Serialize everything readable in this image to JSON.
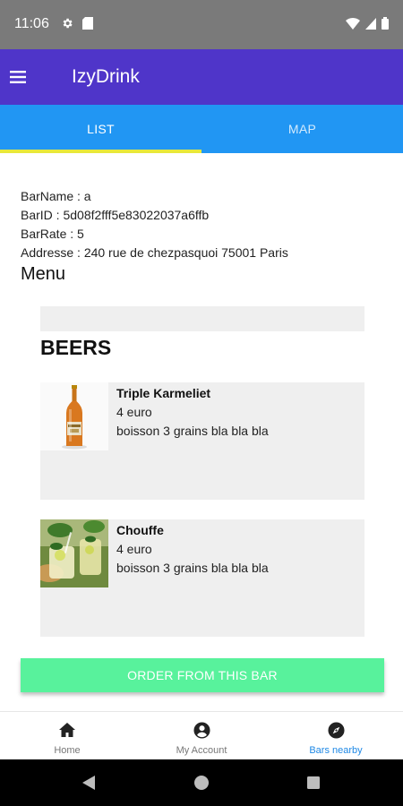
{
  "status_bar": {
    "time": "11:06",
    "icons": [
      "gear-icon",
      "sim-card-icon",
      "wifi-icon",
      "signal-icon",
      "battery-icon"
    ]
  },
  "app_bar": {
    "title": "IzyDrink",
    "menu_icon": "hamburger-menu-icon",
    "color": "#4f35c9"
  },
  "tabs": {
    "items": [
      {
        "label": "LIST",
        "active": true
      },
      {
        "label": "MAP",
        "active": false
      }
    ],
    "background": "#2196f3",
    "indicator_color": "#e8e83a"
  },
  "bar_info": {
    "name": "BarName : a",
    "id": "BarID : 5d08f2fff5e83022037a6ffb",
    "rate": "BarRate : 5",
    "address": "Addresse : 240 rue de chezpasquoi 75001 Paris"
  },
  "menu_heading": "Menu",
  "menu": {
    "category": "BEERS",
    "products": [
      {
        "name": "Triple Karmeliet",
        "price": "4 euro",
        "description": "boisson 3 grains bla bla bla",
        "image": "beer-bottle"
      },
      {
        "name": "Chouffe",
        "price": "4 euro",
        "description": "boisson 3 grains bla bla bla",
        "image": "mojito-glasses"
      }
    ]
  },
  "order_button": {
    "label": "ORDER FROM THIS BAR",
    "color": "#58f29c"
  },
  "bottom_nav": {
    "items": [
      {
        "label": "Home",
        "icon": "home-icon",
        "active": false
      },
      {
        "label": "My Account",
        "icon": "account-circle-icon",
        "active": false
      },
      {
        "label": "Bars nearby",
        "icon": "compass-icon",
        "active": true
      }
    ],
    "active_color": "#1e88e5"
  },
  "system_nav": {
    "icons": [
      "back-icon",
      "home-circle-icon",
      "recents-icon"
    ]
  }
}
